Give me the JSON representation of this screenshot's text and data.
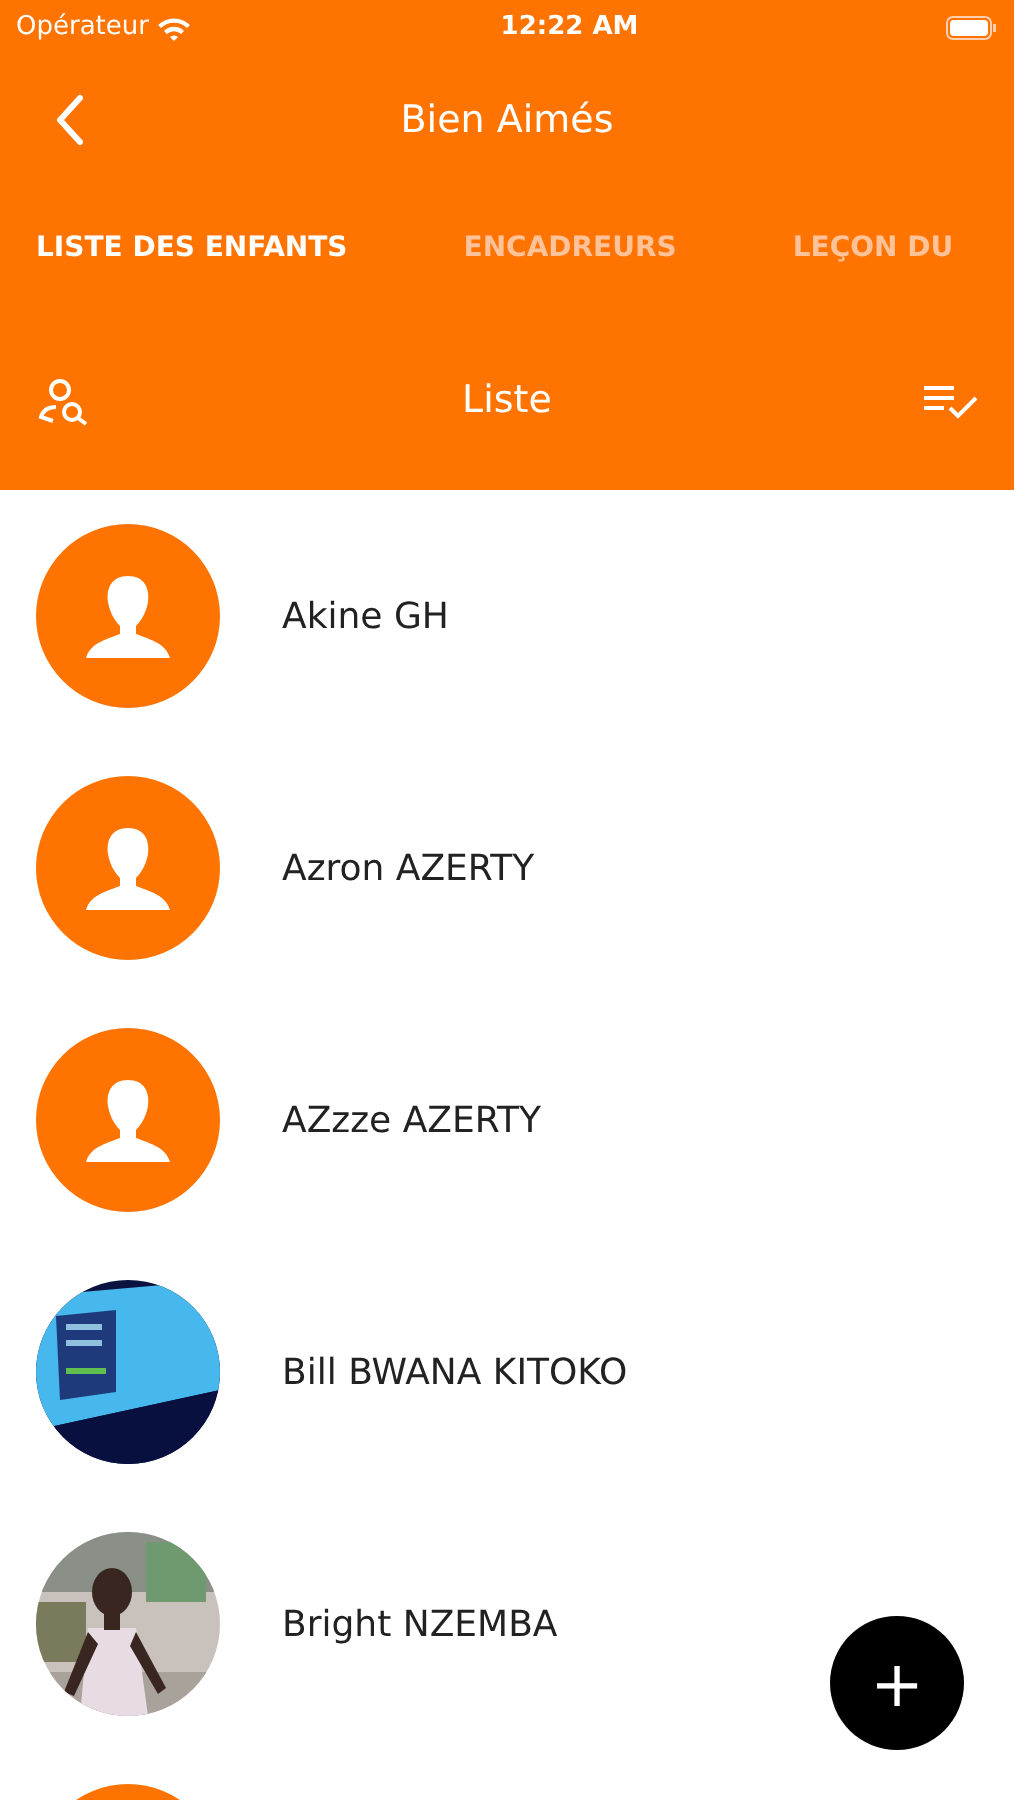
{
  "status_bar": {
    "carrier": "Opérateur",
    "time": "12:22 AM"
  },
  "nav_bar": {
    "title": "Bien Aimés"
  },
  "tabs": [
    {
      "label": "LISTE DES ENFANTS",
      "selected": true
    },
    {
      "label": "ENCADREURS",
      "selected": false
    },
    {
      "label": "LEÇON DU",
      "selected": false
    }
  ],
  "toolbar": {
    "title": "Liste"
  },
  "children": [
    {
      "name": "Akine GH",
      "kind": "placeholder"
    },
    {
      "name": "Azron AZERTY",
      "kind": "placeholder"
    },
    {
      "name": "AZzze AZERTY",
      "kind": "placeholder"
    },
    {
      "name": "Bill BWANA KITOKO",
      "kind": "picture"
    },
    {
      "name": "Bright NZEMBA",
      "kind": "picture"
    },
    {
      "kind": "placeholder"
    }
  ],
  "fab": {
    "label": "+"
  }
}
